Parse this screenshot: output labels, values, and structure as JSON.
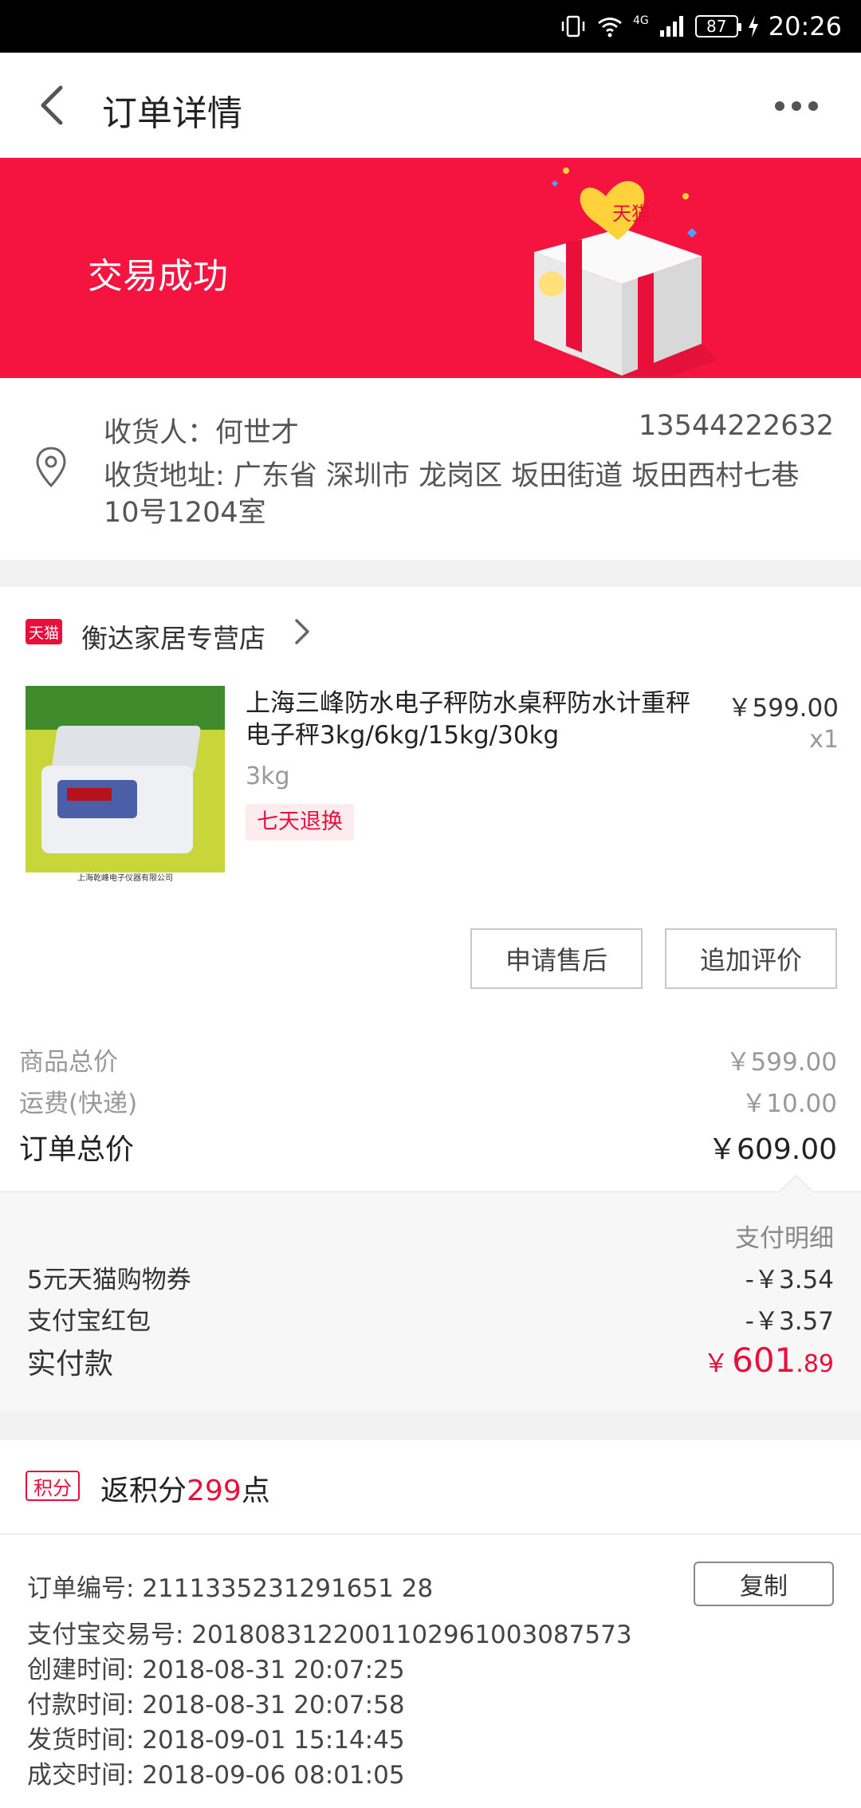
{
  "status_bar": {
    "battery": "87",
    "network": "4G",
    "time": "20:26"
  },
  "header": {
    "title": "订单详情"
  },
  "banner": {
    "status": "交易成功",
    "gift_label": "天猫"
  },
  "address": {
    "consignee": "收货人：何世才",
    "phone": "13544222632",
    "address": "收货地址: 广东省 深圳市 龙岗区 坂田街道 坂田西村七巷10号1204室"
  },
  "store": {
    "badge": "天猫",
    "name": "衡达家居专营店"
  },
  "product": {
    "title": "上海三峰防水电子秤防水桌秤防水计重秤电子秤3kg/6kg/15kg/30kg",
    "price": "￥599.00",
    "quantity": "x1",
    "sku": "3kg",
    "return_policy": "七天退换",
    "image_caption": "上海乾峰电子仪器有限公司"
  },
  "actions": {
    "after_sale": "申请售后",
    "add_review": "追加评价"
  },
  "costs": {
    "goods_label": "商品总价",
    "goods_value": "￥599.00",
    "shipping_label": "运费(快递)",
    "shipping_value": "￥10.00",
    "total_label": "订单总价",
    "total_value": "￥609.00"
  },
  "payment": {
    "details_link": "支付明细",
    "coupon_label": "5元天猫购物券",
    "coupon_value": "-￥3.54",
    "redpacket_label": "支付宝红包",
    "redpacket_value": "-￥3.57",
    "paid_label": "实付款",
    "paid_currency": "￥",
    "paid_int": "601",
    "paid_dec": ".89"
  },
  "points": {
    "badge": "积分",
    "prefix": "返积分",
    "value": "299",
    "suffix": "点"
  },
  "order_info": {
    "order_no": "订单编号: 2111335231291651 28",
    "copy_label": "复制",
    "alipay_no": "支付宝交易号: 2018083122001102961003087573",
    "created": "创建时间: 2018-08-31 20:07:25",
    "paid": "付款时间: 2018-08-31 20:07:58",
    "shipped": "发货时间: 2018-09-01 15:14:45",
    "completed": "成交时间: 2018-09-06 08:01:05"
  },
  "colors": {
    "brand_red": "#f5133f",
    "accent_red": "#e8103b"
  }
}
